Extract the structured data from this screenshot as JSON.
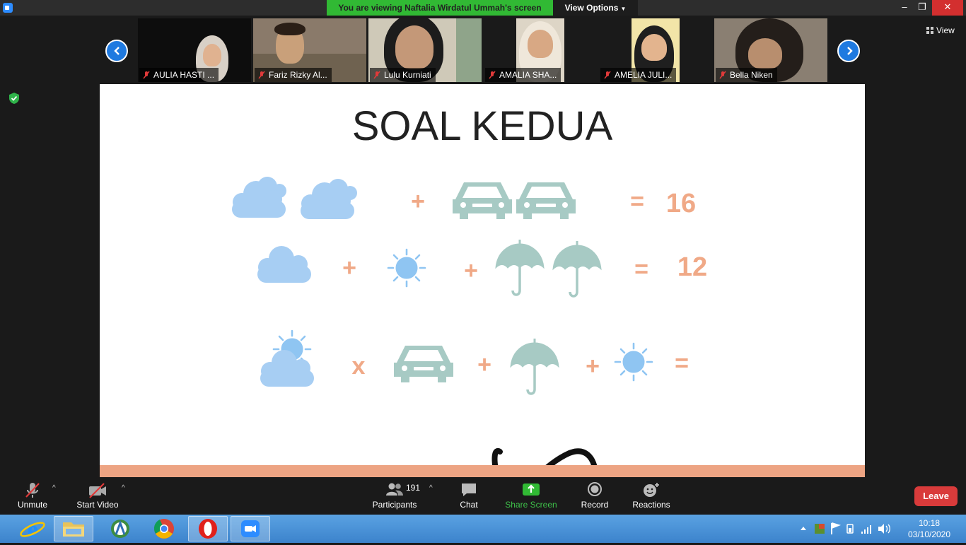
{
  "window": {
    "banner_text": "You are viewing Naftalia Wirdatul Ummah's screen",
    "view_options_label": "View Options",
    "minimize_glyph": "–",
    "restore_glyph": "❐",
    "close_glyph": "✕"
  },
  "participants_strip": {
    "prev_icon": "chevron-left-icon",
    "next_icon": "chevron-right-icon",
    "tiles": [
      {
        "name": "AULIA HASTI ...",
        "muted": true
      },
      {
        "name": "Fariz Rizky Al...",
        "muted": true
      },
      {
        "name": "Lulu Kurniati",
        "muted": true
      },
      {
        "name": "AMALIA SHA...",
        "muted": true
      },
      {
        "name": "AMELIA JULI...",
        "muted": true
      },
      {
        "name": "Bella Niken",
        "muted": true
      }
    ],
    "view_label": "View"
  },
  "slide": {
    "title": "SOAL KEDUA",
    "rows": [
      {
        "items": [
          "cloud-icon",
          "cloud-icon",
          "+",
          "car-icon",
          "car-icon",
          "="
        ],
        "result": "16"
      },
      {
        "items": [
          "cloud-icon",
          "+",
          "sun-icon",
          "+",
          "umbrella-icon",
          "umbrella-icon",
          "="
        ],
        "result": "12"
      },
      {
        "items": [
          "sun-cloud-icon",
          "x",
          "car-icon",
          "+",
          "umbrella-icon",
          "+",
          "sun-icon",
          "="
        ],
        "result": ""
      }
    ],
    "row1_plus": "+",
    "row1_eq": "=",
    "row1_result": "16",
    "row2_plus_a": "+",
    "row2_plus_b": "+",
    "row2_eq": "=",
    "row2_result": "12",
    "row3_times": "x",
    "row3_plus_a": "+",
    "row3_plus_b": "+",
    "row3_eq": "=",
    "colors": {
      "blue": "#a7cef3",
      "teal": "#a7cac4",
      "orange": "#f0a987",
      "sun": "#8fc5f2",
      "band": "#eda483"
    }
  },
  "toolbar": {
    "unmute_label": "Unmute",
    "start_video_label": "Start Video",
    "participants_label": "Participants",
    "participants_count": "191",
    "chat_label": "Chat",
    "share_screen_label": "Share Screen",
    "record_label": "Record",
    "reactions_label": "Reactions",
    "leave_label": "Leave"
  },
  "taskbar": {
    "apps": [
      "internet-explorer-icon",
      "file-explorer-icon",
      "android-studio-icon",
      "chrome-icon",
      "opera-icon",
      "zoom-icon"
    ],
    "time": "10:18",
    "date": "03/10/2020"
  }
}
